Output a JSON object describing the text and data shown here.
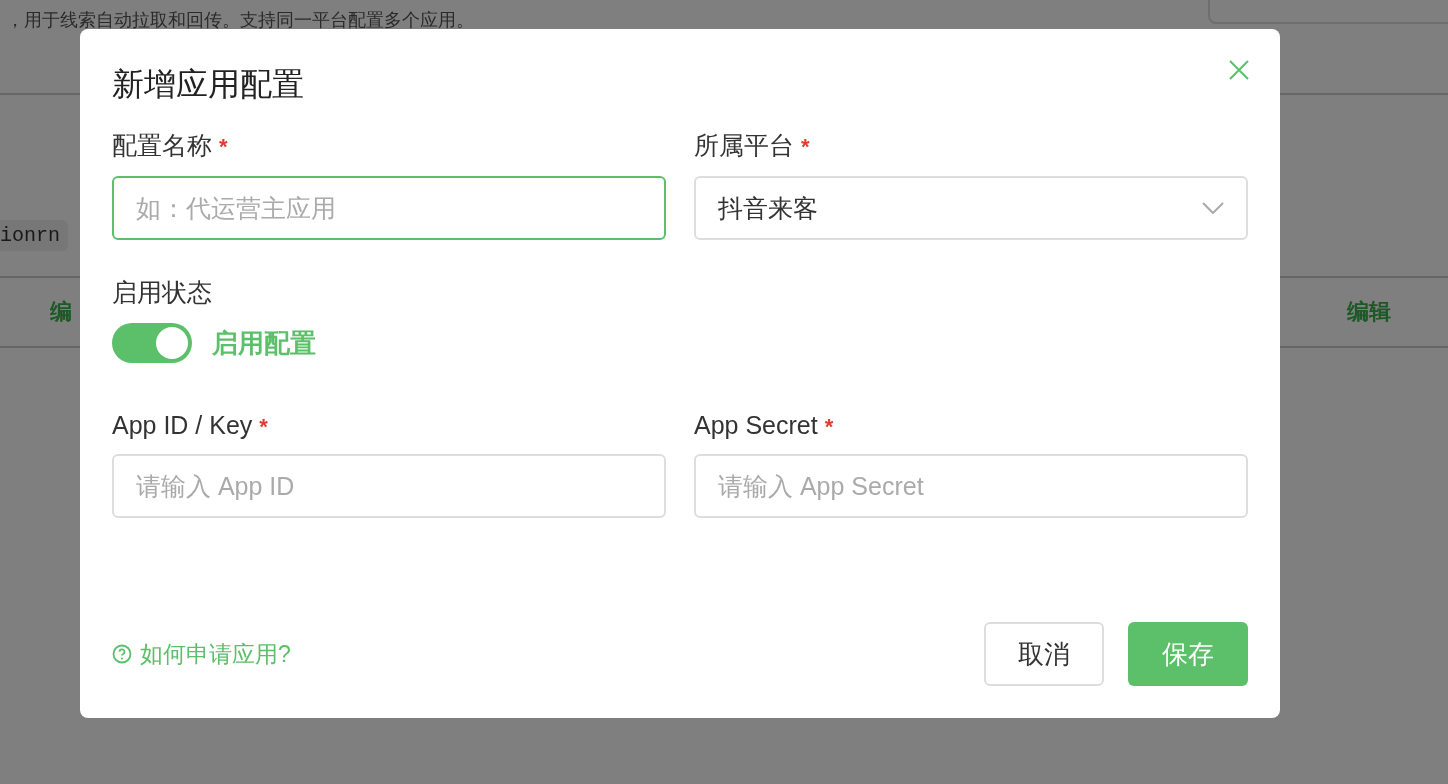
{
  "background": {
    "description": "，用于线索自动拉取和回传。支持同一平台配置多个应用。",
    "code": "ionrn",
    "row": {
      "action_left": "编",
      "action_right": "编辑"
    }
  },
  "dialog": {
    "title": "新增应用配置",
    "fields": [
      {
        "label": "配置名称",
        "required_mark": "*",
        "kind": "input",
        "placeholder": "如：代运营主应用",
        "focused": true
      },
      {
        "label": "所属平台",
        "required_mark": "*",
        "kind": "select",
        "value": "抖音来客",
        "focused": false
      }
    ],
    "status": {
      "label": "启用状态",
      "on": true,
      "text": "启用配置"
    },
    "credentials": [
      {
        "label": "App ID / Key",
        "required_mark": "*",
        "kind": "input",
        "placeholder": "请输入 App ID",
        "focused": false
      },
      {
        "label": "App Secret",
        "required_mark": "*",
        "kind": "input",
        "placeholder": "请输入 App Secret",
        "focused": false
      }
    ],
    "help_link": "如何申请应用?",
    "buttons": [
      {
        "label": "取消",
        "kind": "secondary"
      },
      {
        "label": "保存",
        "kind": "primary"
      }
    ]
  }
}
